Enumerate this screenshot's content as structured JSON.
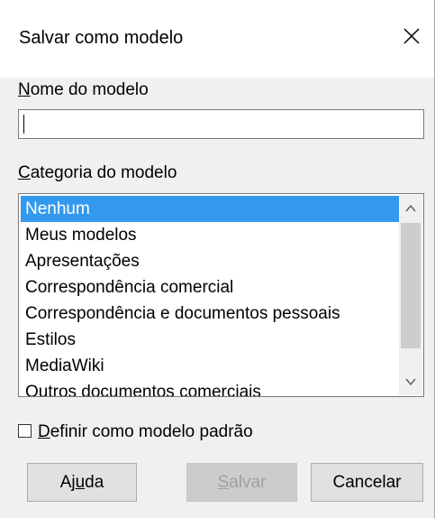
{
  "window": {
    "title": "Salvar como modelo",
    "close_icon": "close-icon"
  },
  "name_field": {
    "label_accel": "N",
    "label_rest": "ome do modelo",
    "value": ""
  },
  "category": {
    "label_accel": "C",
    "label_rest": "ategoria do modelo",
    "items": [
      "Nenhum",
      "Meus modelos",
      "Apresentações",
      "Correspondência comercial",
      "Correspondência e documentos pessoais",
      "Estilos",
      "MediaWiki",
      "Outros documentos comerciais"
    ],
    "selected_index": 0
  },
  "default_checkbox": {
    "label_accel": "D",
    "label_rest": "efinir como modelo padrão",
    "checked": false
  },
  "buttons": {
    "help_pre": "Aj",
    "help_accel": "u",
    "help_post": "da",
    "save_accel": "S",
    "save_rest": "alvar",
    "cancel": "Cancelar"
  },
  "colors": {
    "selection": "#3399ee",
    "dialog_bg": "#f0f0f0"
  }
}
